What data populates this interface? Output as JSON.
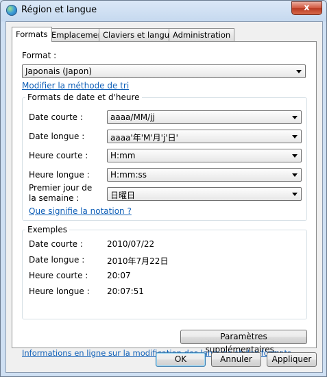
{
  "window": {
    "title": "Région et langue",
    "close_label": "x"
  },
  "tabs": [
    {
      "label": "Formats"
    },
    {
      "label": "Emplacement"
    },
    {
      "label": "Claviers et langues"
    },
    {
      "label": "Administration"
    }
  ],
  "format": {
    "label": "Format :",
    "value": "Japonais (Japon)",
    "sort_link": "Modifier la méthode de tri"
  },
  "datetime": {
    "group_title": "Formats de date et d'heure",
    "fields": [
      {
        "label": "Date courte :",
        "value": "aaaa/MM/jj"
      },
      {
        "label": "Date longue :",
        "value": "aaaa'年'M'月'j'日'"
      },
      {
        "label": "Heure courte :",
        "value": "H:mm"
      },
      {
        "label": "Heure longue :",
        "value": "H:mm:ss"
      },
      {
        "label": "Premier jour de",
        "label2": "la semaine :",
        "value": "日曜日"
      }
    ],
    "notation_link": "Que signifie la notation ?"
  },
  "examples": {
    "group_title": "Exemples",
    "rows": [
      {
        "label": "Date courte :",
        "value": "2010/07/22"
      },
      {
        "label": "Date longue :",
        "value": "2010年7月22日"
      },
      {
        "label": "Heure courte :",
        "value": "20:07"
      },
      {
        "label": "Heure longue :",
        "value": "20:07:51"
      }
    ]
  },
  "more_settings_button": "Paramètres supplémentaires...",
  "online_info_link": "Informations en ligne sur la modification des langues et des formats.",
  "footer": {
    "ok": "OK",
    "cancel": "Annuler",
    "apply": "Appliquer"
  }
}
